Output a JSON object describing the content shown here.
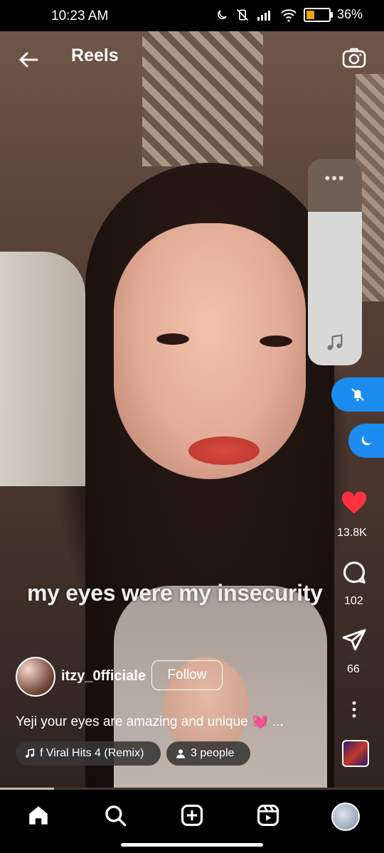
{
  "status": {
    "time": "10:23 AM",
    "battery": "36%",
    "battery_level": 0.36
  },
  "header": {
    "title": "Reels"
  },
  "video": {
    "subtitle": "my eyes were my insecurity"
  },
  "actions": {
    "likes": "13.8K",
    "comments": "102",
    "shares": "66"
  },
  "user": {
    "username": "itzy_0fficiale",
    "follow_label": "Follow"
  },
  "caption": {
    "text": "Yeji your eyes are amazing and unique",
    "emoji": "💓",
    "more": "..."
  },
  "chips": {
    "music": "f Viral Hits 4 (Remix)",
    "people": "3 people"
  },
  "playback": {
    "progress": 0.14
  },
  "colors": {
    "accent_blue": "#1d8cf0",
    "like_red": "#ff3040",
    "battery_orange": "#f0a500"
  }
}
